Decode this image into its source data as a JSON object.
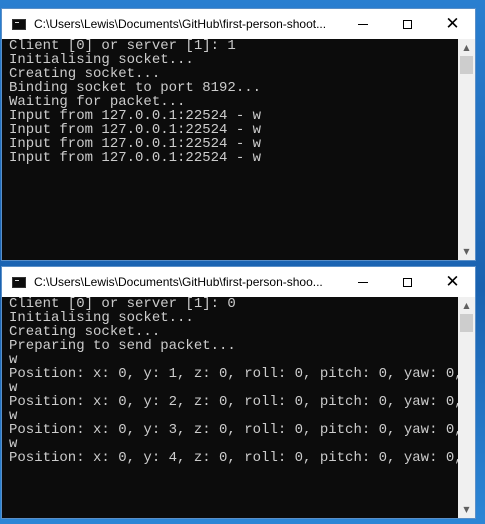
{
  "windows": [
    {
      "title": "C:\\Users\\Lewis\\Documents\\GitHub\\first-person-shoot...",
      "lines": [
        "Client [0] or server [1]: 1",
        "Initialising socket...",
        "Creating socket...",
        "Binding socket to port 8192...",
        "Waiting for packet...",
        "Input from 127.0.0.1:22524 - w",
        "Input from 127.0.0.1:22524 - w",
        "Input from 127.0.0.1:22524 - w",
        "Input from 127.0.0.1:22524 - w"
      ]
    },
    {
      "title": "C:\\Users\\Lewis\\Documents\\GitHub\\first-person-shoo...",
      "lines": [
        "Client [0] or server [1]: 0",
        "Initialising socket...",
        "Creating socket...",
        "Preparing to send packet...",
        "w",
        "Position: x: 0, y: 1, z: 0, roll: 0, pitch: 0, yaw: 0,",
        "w",
        "Position: x: 0, y: 2, z: 0, roll: 0, pitch: 0, yaw: 0,",
        "w",
        "Position: x: 0, y: 3, z: 0, roll: 0, pitch: 0, yaw: 0,",
        "w",
        "Position: x: 0, y: 4, z: 0, roll: 0, pitch: 0, yaw: 0,"
      ]
    }
  ],
  "controls": {
    "minimize_icon": "minimize-icon",
    "maximize_icon": "maximize-icon",
    "close_icon": "close-icon",
    "close_glyph": "✕",
    "scroll_up_glyph": "▲",
    "scroll_down_glyph": "▼"
  },
  "colors": {
    "console_bg": "#0c0c0c",
    "console_text": "#cccccc",
    "titlebar_bg": "#ffffff",
    "desktop": "#1f6ab5"
  }
}
